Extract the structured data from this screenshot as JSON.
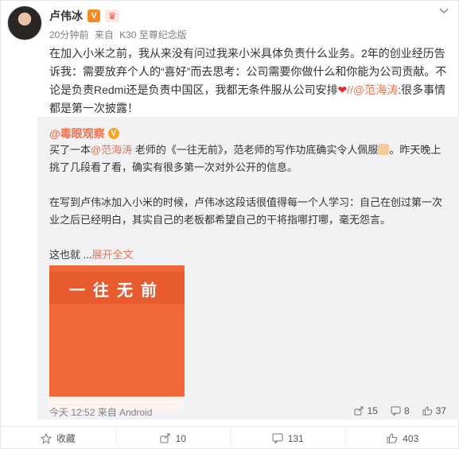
{
  "post": {
    "author": "卢伟冰",
    "time": "20分钟前",
    "source_prefix": "来自",
    "source": "K30 至尊纪念版",
    "text_part1": "在加入小米之前，我从来没有问过我来小米具体负责什么业务。2年的创业经历告诉我：需要放弃个人的“喜好”而去思考：公司需要你做什么和你能为公司贡献。不论是负责Redmi还是负责中国区，我都无条件服从公司安排",
    "text_sep": "//",
    "mention": "@范海涛",
    "text_part2": ":很多事情都是第一次披露！"
  },
  "repost": {
    "user": "@毒眼观察",
    "para1_part1": "买了一本",
    "para1_mention": "@范海涛",
    "para1_part2": " 老师的《一往无前》，范老师的写作功底确实令人佩服",
    "para1_part3": "。昨天晚上挑了几段看了看，确实有很多第一次对外公开的信息。",
    "para2": "在写到卢伟冰加入小米的时候，卢伟冰这段话很值得每一个人学习：自己在创过第一次业之后已经明白，其实自己的老板都希望自己的干将指哪打哪，毫无怨言。",
    "para3": "这也就 ...",
    "expand_label": "展开全文",
    "image_title": "一往无前",
    "footer_time": "今天 12:52 来自 Android",
    "shares": "15",
    "comments": "8",
    "likes": "37"
  },
  "toolbar": {
    "favorite_label": "收藏",
    "share_count": "10",
    "comment_count": "131",
    "like_count": "403"
  },
  "colors": {
    "accent": "#eb7350",
    "repost_bg": "#f2f2f5",
    "book_cover": "#f0673a"
  }
}
